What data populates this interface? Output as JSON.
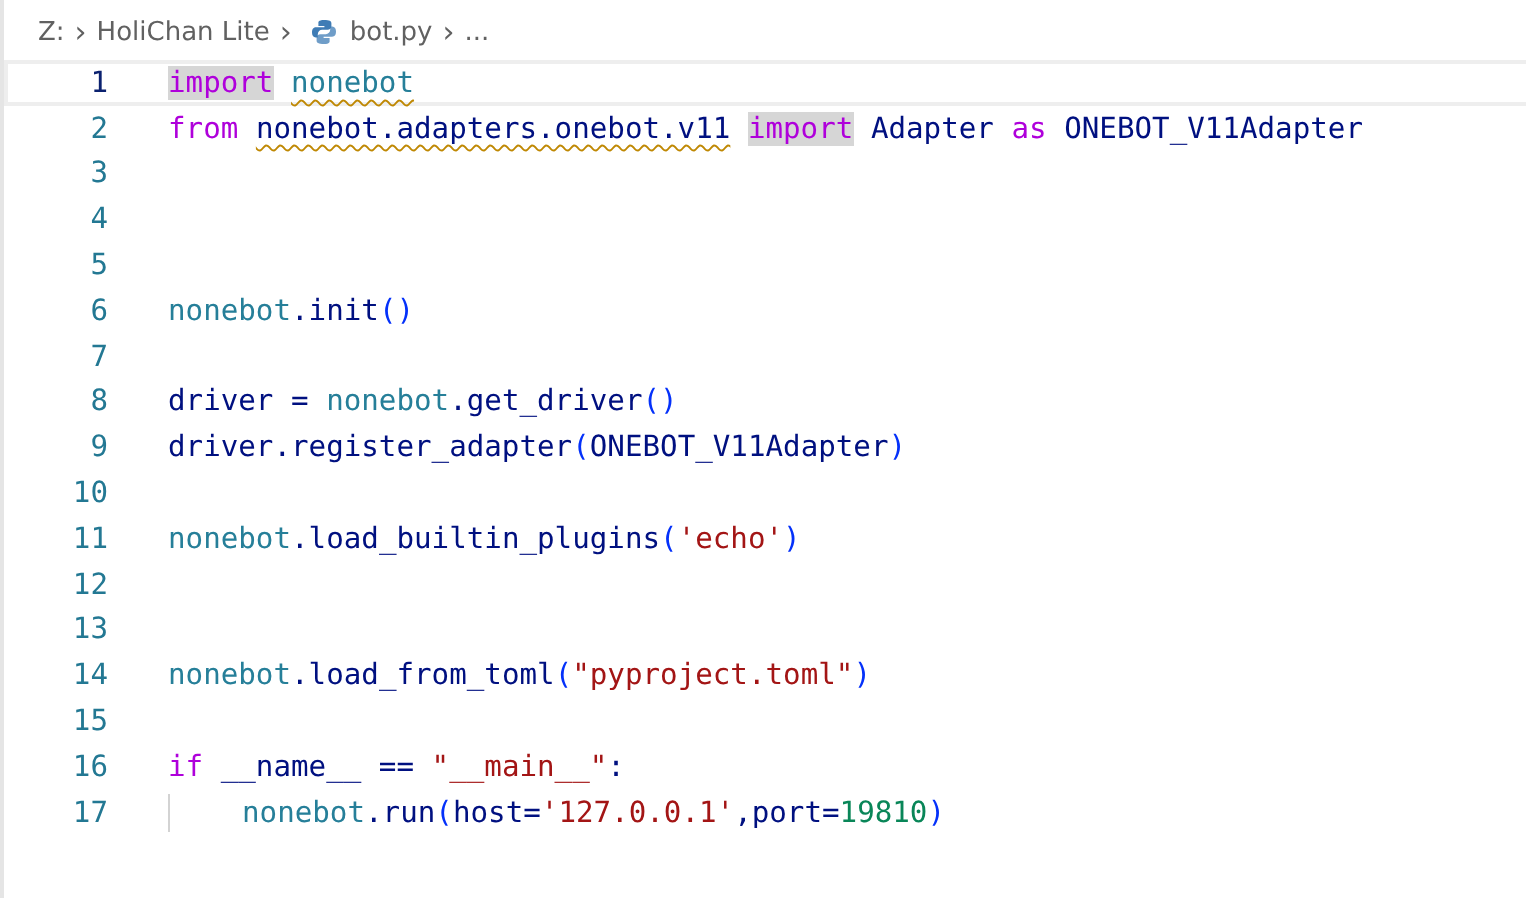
{
  "breadcrumb": {
    "items": [
      {
        "text": "Z:",
        "kind": "folder"
      },
      {
        "text": "›",
        "kind": "separator"
      },
      {
        "text": "HoliChan Lite",
        "kind": "folder"
      },
      {
        "text": "›",
        "kind": "separator"
      },
      {
        "text": "bot.py",
        "kind": "python-file"
      },
      {
        "text": "›",
        "kind": "separator"
      },
      {
        "text": "...",
        "kind": "more"
      }
    ]
  },
  "editor": {
    "lines": [
      {
        "number": "1",
        "current": true,
        "indented": false,
        "tokens": [
          {
            "text": "import",
            "kind": "keyword",
            "highlight": true,
            "squiggle": false,
            "spaced": true
          },
          {
            "text": "nonebot",
            "kind": "module",
            "highlight": false,
            "squiggle": true,
            "spaced": false
          }
        ]
      },
      {
        "number": "2",
        "current": false,
        "indented": false,
        "tokens": [
          {
            "text": "from",
            "kind": "keyword",
            "highlight": false,
            "squiggle": false,
            "spaced": true
          },
          {
            "text": "nonebot.adapters.onebot.v11",
            "kind": "plain",
            "highlight": false,
            "squiggle": true,
            "spaced": true
          },
          {
            "text": "import",
            "kind": "keyword",
            "highlight": true,
            "squiggle": false,
            "spaced": true
          },
          {
            "text": "Adapter",
            "kind": "plain",
            "highlight": false,
            "squiggle": false,
            "spaced": true
          },
          {
            "text": "as",
            "kind": "keyword",
            "highlight": false,
            "squiggle": false,
            "spaced": true
          },
          {
            "text": "ONEBOT_V11Adapter",
            "kind": "plain",
            "highlight": false,
            "squiggle": false,
            "spaced": false
          }
        ]
      },
      {
        "number": "3",
        "current": false,
        "indented": false
      },
      {
        "number": "4",
        "current": false,
        "indented": false
      },
      {
        "number": "5",
        "current": false,
        "indented": false
      },
      {
        "number": "6",
        "current": false,
        "indented": false,
        "tokens": [
          {
            "text": "nonebot",
            "kind": "module",
            "highlight": false,
            "squiggle": false,
            "spaced": false
          },
          {
            "text": ".init",
            "kind": "plain",
            "highlight": false,
            "squiggle": false,
            "spaced": false
          },
          {
            "text": "()",
            "kind": "bracket",
            "highlight": false,
            "squiggle": false,
            "spaced": false
          }
        ]
      },
      {
        "number": "7",
        "current": false,
        "indented": false
      },
      {
        "number": "8",
        "current": false,
        "indented": false,
        "tokens": [
          {
            "text": "driver =",
            "kind": "plain",
            "highlight": false,
            "squiggle": false,
            "spaced": true
          },
          {
            "text": "nonebot",
            "kind": "module",
            "highlight": false,
            "squiggle": false,
            "spaced": false
          },
          {
            "text": ".get_driver",
            "kind": "plain",
            "highlight": false,
            "squiggle": false,
            "spaced": false
          },
          {
            "text": "()",
            "kind": "bracket",
            "highlight": false,
            "squiggle": false,
            "spaced": false
          }
        ]
      },
      {
        "number": "9",
        "current": false,
        "indented": false,
        "tokens": [
          {
            "text": "driver.register_adapter",
            "kind": "plain",
            "highlight": false,
            "squiggle": false,
            "spaced": false
          },
          {
            "text": "(",
            "kind": "bracket",
            "highlight": false,
            "squiggle": false,
            "spaced": false
          },
          {
            "text": "ONEBOT_V11Adapter",
            "kind": "plain",
            "highlight": false,
            "squiggle": false,
            "spaced": false
          },
          {
            "text": ")",
            "kind": "bracket",
            "highlight": false,
            "squiggle": false,
            "spaced": false
          }
        ]
      },
      {
        "number": "10",
        "current": false,
        "indented": false
      },
      {
        "number": "11",
        "current": false,
        "indented": false,
        "tokens": [
          {
            "text": "nonebot",
            "kind": "module",
            "highlight": false,
            "squiggle": false,
            "spaced": false
          },
          {
            "text": ".load_builtin_plugins",
            "kind": "plain",
            "highlight": false,
            "squiggle": false,
            "spaced": false
          },
          {
            "text": "(",
            "kind": "bracket",
            "highlight": false,
            "squiggle": false,
            "spaced": false
          },
          {
            "text": "'echo'",
            "kind": "string",
            "highlight": false,
            "squiggle": false,
            "spaced": false
          },
          {
            "text": ")",
            "kind": "bracket",
            "highlight": false,
            "squiggle": false,
            "spaced": false
          }
        ]
      },
      {
        "number": "12",
        "current": false,
        "indented": false
      },
      {
        "number": "13",
        "current": false,
        "indented": false
      },
      {
        "number": "14",
        "current": false,
        "indented": false,
        "tokens": [
          {
            "text": "nonebot",
            "kind": "module",
            "highlight": false,
            "squiggle": false,
            "spaced": false
          },
          {
            "text": ".load_from_toml",
            "kind": "plain",
            "highlight": false,
            "squiggle": false,
            "spaced": false
          },
          {
            "text": "(",
            "kind": "bracket",
            "highlight": false,
            "squiggle": false,
            "spaced": false
          },
          {
            "text": "\"pyproject.toml\"",
            "kind": "string",
            "highlight": false,
            "squiggle": false,
            "spaced": false
          },
          {
            "text": ")",
            "kind": "bracket",
            "highlight": false,
            "squiggle": false,
            "spaced": false
          }
        ]
      },
      {
        "number": "15",
        "current": false,
        "indented": false
      },
      {
        "number": "16",
        "current": false,
        "indented": false,
        "tokens": [
          {
            "text": "if",
            "kind": "keyword",
            "highlight": false,
            "squiggle": false,
            "spaced": true
          },
          {
            "text": "__name__ ==",
            "kind": "plain",
            "highlight": false,
            "squiggle": false,
            "spaced": true
          },
          {
            "text": "\"__main__\"",
            "kind": "string",
            "highlight": false,
            "squiggle": false,
            "spaced": false
          },
          {
            "text": ":",
            "kind": "plain",
            "highlight": false,
            "squiggle": false,
            "spaced": false
          }
        ]
      },
      {
        "number": "17",
        "current": false,
        "indented": true,
        "tokens": [
          {
            "text": "nonebot",
            "kind": "module",
            "highlight": false,
            "squiggle": false,
            "spaced": false
          },
          {
            "text": ".run",
            "kind": "plain",
            "highlight": false,
            "squiggle": false,
            "spaced": false
          },
          {
            "text": "(",
            "kind": "bracket",
            "highlight": false,
            "squiggle": false,
            "spaced": false
          },
          {
            "text": "host=",
            "kind": "plain",
            "highlight": false,
            "squiggle": false,
            "spaced": false
          },
          {
            "text": "'127.0.0.1'",
            "kind": "string",
            "highlight": false,
            "squiggle": false,
            "spaced": false
          },
          {
            "text": ",port=",
            "kind": "plain",
            "highlight": false,
            "squiggle": false,
            "spaced": false
          },
          {
            "text": "19810",
            "kind": "number",
            "highlight": false,
            "squiggle": false,
            "spaced": false
          },
          {
            "text": ")",
            "kind": "bracket",
            "highlight": false,
            "squiggle": false,
            "spaced": false
          }
        ]
      }
    ]
  }
}
